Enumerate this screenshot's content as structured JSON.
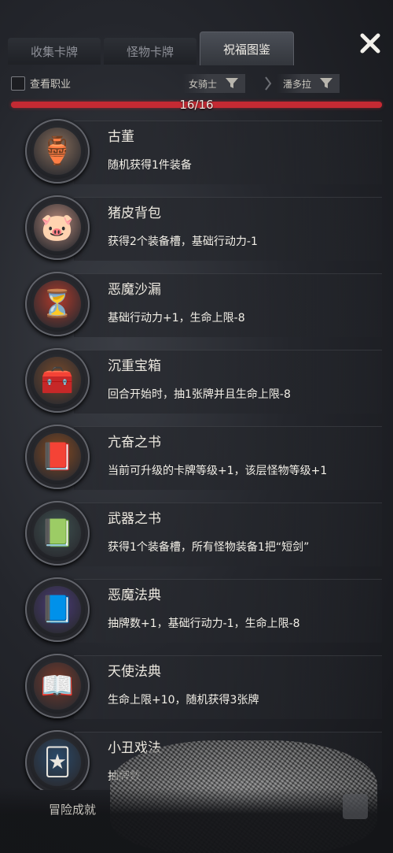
{
  "tabs": [
    {
      "label": "收集卡牌",
      "active": false
    },
    {
      "label": "怪物卡牌",
      "active": false
    },
    {
      "label": "祝福图鉴",
      "active": true
    }
  ],
  "close_icon": "close-icon",
  "filter": {
    "checkbox_label": "查看职业",
    "checked": false,
    "dropdown_class": "女骑士",
    "dropdown_character": "潘多拉",
    "dropdown_icon": "funnel-icon"
  },
  "progress": {
    "text": "16/16",
    "fraction": 1.0
  },
  "blessings": [
    {
      "name": "古董",
      "desc": "随机获得1件装备",
      "icon": "antique-statue-icon",
      "glyph": "🏺",
      "color": "#8a6e5a"
    },
    {
      "name": "猪皮背包",
      "desc": "获得2个装备槽，基础行动力-1",
      "icon": "pigskin-backpack-icon",
      "glyph": "🐷",
      "color": "#b98a7a"
    },
    {
      "name": "恶魔沙漏",
      "desc": "基础行动力+1，生命上限-8",
      "icon": "demon-hourglass-icon",
      "glyph": "⏳",
      "color": "#b33a2a"
    },
    {
      "name": "沉重宝箱",
      "desc": "回合开始时，抽1张牌并且生命上限-8",
      "icon": "heavy-chest-icon",
      "glyph": "🧰",
      "color": "#7a4a2a"
    },
    {
      "name": "亢奋之书",
      "desc": "当前可升级的卡牌等级+1，该层怪物等级+1",
      "icon": "excitement-book-icon",
      "glyph": "📕",
      "color": "#8a4a1e"
    },
    {
      "name": "武器之书",
      "desc": "获得1个装备槽，所有怪物装备1把“短剑”",
      "icon": "weapon-book-icon",
      "glyph": "📗",
      "color": "#3e5250"
    },
    {
      "name": "恶魔法典",
      "desc": "抽牌数+1，基础行动力-1，生命上限-8",
      "icon": "demon-codex-icon",
      "glyph": "📘",
      "color": "#4a3a7a"
    },
    {
      "name": "天使法典",
      "desc": "生命上限+10，随机获得3张牌",
      "icon": "angel-codex-icon",
      "glyph": "📖",
      "color": "#7a3a2a"
    },
    {
      "name": "小丑戏法",
      "desc": "抽牌数",
      "icon": "clown-trick-icon",
      "glyph": "🃏",
      "color": "#2a4a6a"
    }
  ],
  "bottom": {
    "achievements_label": "冒险成就"
  }
}
